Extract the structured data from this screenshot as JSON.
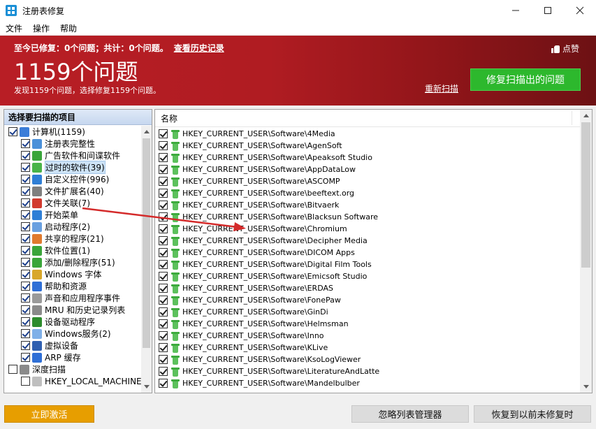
{
  "window": {
    "title": "注册表修复"
  },
  "menu": [
    "文件",
    "操作",
    "帮助"
  ],
  "banner": {
    "summary": "至今已修复：0个问题；共计：0个问题。",
    "history_link": "查看历史记录",
    "count": "1159个问题",
    "description": "发现1159个问题，选择修复1159个问题。",
    "like": "点赞",
    "rescan": "重新扫描",
    "fix_button": "修复扫描出的问题"
  },
  "left_panel": {
    "header": "选择要扫描的项目",
    "items": [
      {
        "label": "计算机(1159)",
        "indent": 0,
        "checked": true,
        "icon": "computer-icon",
        "color": "#3b7dd8"
      },
      {
        "label": "注册表完整性",
        "indent": 1,
        "checked": true,
        "icon": "registry-icon",
        "color": "#4a90d9"
      },
      {
        "label": "广告软件和间谍软件",
        "indent": 1,
        "checked": true,
        "icon": "shield-icon",
        "color": "#3aa53a"
      },
      {
        "label": "过时的软件(39)",
        "indent": 1,
        "checked": true,
        "icon": "trash-icon",
        "color": "#49b449",
        "selected": true
      },
      {
        "label": "自定义控件(996)",
        "indent": 1,
        "checked": true,
        "icon": "controls-icon",
        "color": "#2f7fd6"
      },
      {
        "label": "文件扩展名(40)",
        "indent": 1,
        "checked": true,
        "icon": "file-ext-icon",
        "color": "#7f7f7f"
      },
      {
        "label": "文件关联(7)",
        "indent": 1,
        "checked": true,
        "icon": "file-assoc-icon",
        "color": "#d23a2e"
      },
      {
        "label": "开始菜单",
        "indent": 1,
        "checked": true,
        "icon": "start-menu-icon",
        "color": "#2f7fd6"
      },
      {
        "label": "启动程序(2)",
        "indent": 1,
        "checked": true,
        "icon": "startup-icon",
        "color": "#6aa0e0"
      },
      {
        "label": "共享的程序(21)",
        "indent": 1,
        "checked": true,
        "icon": "shared-icon",
        "color": "#e07a2e"
      },
      {
        "label": "软件位置(1)",
        "indent": 1,
        "checked": true,
        "icon": "software-location-icon",
        "color": "#3aa53a"
      },
      {
        "label": "添加/删除程序(51)",
        "indent": 1,
        "checked": true,
        "icon": "add-remove-icon",
        "color": "#3aa53a"
      },
      {
        "label": "Windows 字体",
        "indent": 1,
        "checked": true,
        "icon": "font-icon",
        "color": "#d8a72a"
      },
      {
        "label": "帮助和资源",
        "indent": 1,
        "checked": true,
        "icon": "help-icon",
        "color": "#2f6fd6"
      },
      {
        "label": "声音和应用程序事件",
        "indent": 1,
        "checked": true,
        "icon": "sound-icon",
        "color": "#9a9a9a"
      },
      {
        "label": "MRU 和历史记录列表",
        "indent": 1,
        "checked": true,
        "icon": "history-icon",
        "color": "#8a8a8a"
      },
      {
        "label": "设备驱动程序",
        "indent": 1,
        "checked": true,
        "icon": "driver-icon",
        "color": "#2d8c2d"
      },
      {
        "label": "Windows服务(2)",
        "indent": 1,
        "checked": true,
        "icon": "services-icon",
        "color": "#7fb0e8"
      },
      {
        "label": "虚拟设备",
        "indent": 1,
        "checked": true,
        "icon": "virtual-device-icon",
        "color": "#2f5fb0"
      },
      {
        "label": "ARP 缓存",
        "indent": 1,
        "checked": true,
        "icon": "arp-icon",
        "color": "#2f6fd6"
      },
      {
        "label": "深度扫描",
        "indent": 0,
        "checked": false,
        "icon": "deep-scan-icon",
        "color": "#8a8a8a"
      },
      {
        "label": "HKEY_LOCAL_MACHINE",
        "indent": 1,
        "checked": false,
        "icon": "hive-icon",
        "color": "#bfbfbf"
      }
    ]
  },
  "right_panel": {
    "column_header": "名称",
    "rows": [
      "HKEY_CURRENT_USER\\Software\\4Media",
      "HKEY_CURRENT_USER\\Software\\AgenSoft",
      "HKEY_CURRENT_USER\\Software\\Apeaksoft Studio",
      "HKEY_CURRENT_USER\\Software\\AppDataLow",
      "HKEY_CURRENT_USER\\Software\\ASCOMP",
      "HKEY_CURRENT_USER\\Software\\beeftext.org",
      "HKEY_CURRENT_USER\\Software\\Bitvaerk",
      "HKEY_CURRENT_USER\\Software\\Blacksun Software",
      "HKEY_CURRENT_USER\\Software\\Chromium",
      "HKEY_CURRENT_USER\\Software\\Decipher Media",
      "HKEY_CURRENT_USER\\Software\\DICOM Apps",
      "HKEY_CURRENT_USER\\Software\\Digital Film Tools",
      "HKEY_CURRENT_USER\\Software\\Emicsoft Studio",
      "HKEY_CURRENT_USER\\Software\\ERDAS",
      "HKEY_CURRENT_USER\\Software\\FonePaw",
      "HKEY_CURRENT_USER\\Software\\GinDi",
      "HKEY_CURRENT_USER\\Software\\Helmsman",
      "HKEY_CURRENT_USER\\Software\\Inno",
      "HKEY_CURRENT_USER\\Software\\KLive",
      "HKEY_CURRENT_USER\\Software\\KsoLogViewer",
      "HKEY_CURRENT_USER\\Software\\LiteratureAndLatte",
      "HKEY_CURRENT_USER\\Software\\Mandelbulber"
    ]
  },
  "buttons": {
    "activate": "立即激活",
    "ignore_list": "忽略列表管理器",
    "restore": "恢复到以前未修复时"
  },
  "colors": {
    "banner_red": "#b81e25",
    "fix_green": "#2db82d",
    "activate_orange": "#e79e00"
  }
}
